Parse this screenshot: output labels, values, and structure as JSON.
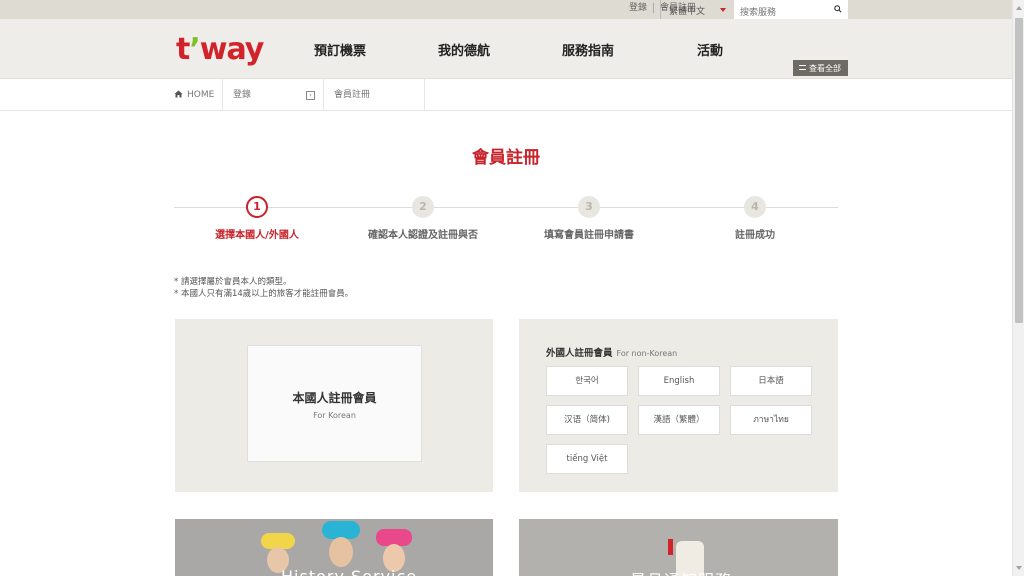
{
  "util": {
    "login": "登錄",
    "signup": "會員註冊",
    "language": "繁體中文",
    "search_placeholder": "搜索服務"
  },
  "logo": {
    "t": "t",
    "q": "’",
    "way": "way"
  },
  "gnb": {
    "menu": [
      "預訂機票",
      "我的德航",
      "服務指南",
      "活動"
    ],
    "view_all": "查看全部"
  },
  "breadcrumb": {
    "home": "HOME",
    "level1": "登錄",
    "level2": "會員註冊"
  },
  "page_title": "會員註冊",
  "steps": [
    {
      "num": "1",
      "label": "選擇本國人/外國人",
      "active": true
    },
    {
      "num": "2",
      "label": "確認本人認證及註冊與否",
      "active": false
    },
    {
      "num": "3",
      "label": "填寫會員註冊申請書",
      "active": false
    },
    {
      "num": "4",
      "label": "註冊成功",
      "active": false
    }
  ],
  "notes": [
    "* 請選擇屬於會員本人的類型。",
    "* 本國人只有滿14歲以上的旅客才能註冊會員。"
  ],
  "korean": {
    "title": "本國人註冊會員",
    "subtitle": "For Korean"
  },
  "foreign": {
    "title": "外國人註冊會員",
    "subtitle": "For non-Korean",
    "languages": [
      "한국어",
      "English",
      "日本語",
      "汉语（简体)",
      "漢語（繁體）",
      "ภาษาไทย",
      "tiếng Việt"
    ]
  },
  "banners": {
    "left": "History Service",
    "right": "最旦通知服務"
  },
  "colors": {
    "brand_red": "#d2232a",
    "brand_green": "#7fbf2a",
    "panel_bg": "#edebe6"
  }
}
